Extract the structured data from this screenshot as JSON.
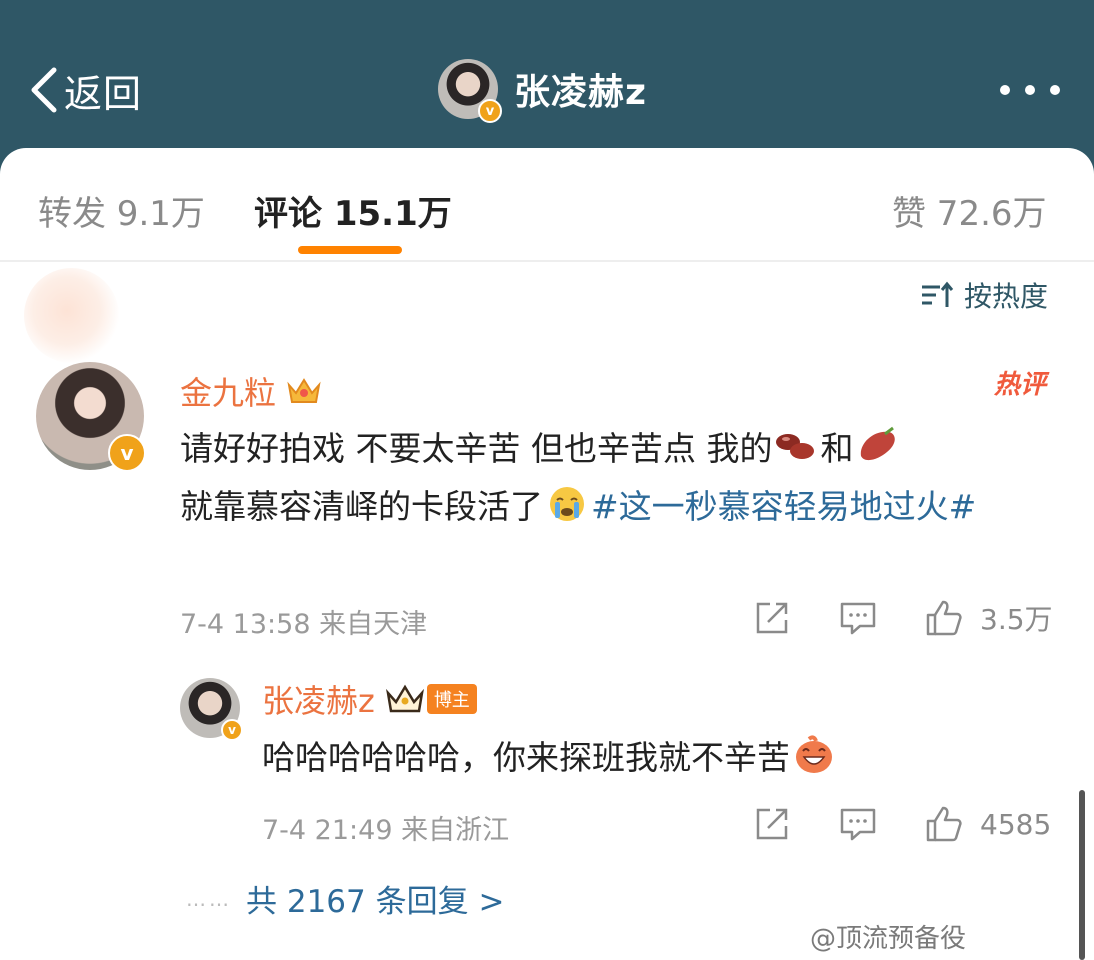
{
  "header": {
    "back_label": "返回",
    "title": "张凌赫z"
  },
  "tabs": [
    {
      "label": "转发 9.1万"
    },
    {
      "label": "评论 15.1万"
    },
    {
      "label": "赞 72.6万"
    }
  ],
  "sort_label": "按热度",
  "comment": {
    "author": "金九粒",
    "hot_badge": "热评",
    "text_part1": "请好好拍戏 不要太辛苦 但也辛苦点 我的",
    "text_part2": "和",
    "text_part3": "就靠慕容清峄的卡段活了",
    "topic": "#这一秒慕容轻易地过火#",
    "time_location": "7-4 13:58 来自天津",
    "likes": "3.5万"
  },
  "reply": {
    "author": "张凌赫z",
    "badge": "博主",
    "text": "哈哈哈哈哈哈，你来探班我就不辛苦",
    "time_location": "7-4 21:49 来自浙江",
    "likes": "4585"
  },
  "more_replies": "共 2167 条回复 >",
  "watermark": "@顶流预备役",
  "colors": {
    "header_bg": "#2f5766",
    "accent_orange": "#ff8200",
    "username": "#eb7340",
    "topic_link": "#2d6a99"
  }
}
